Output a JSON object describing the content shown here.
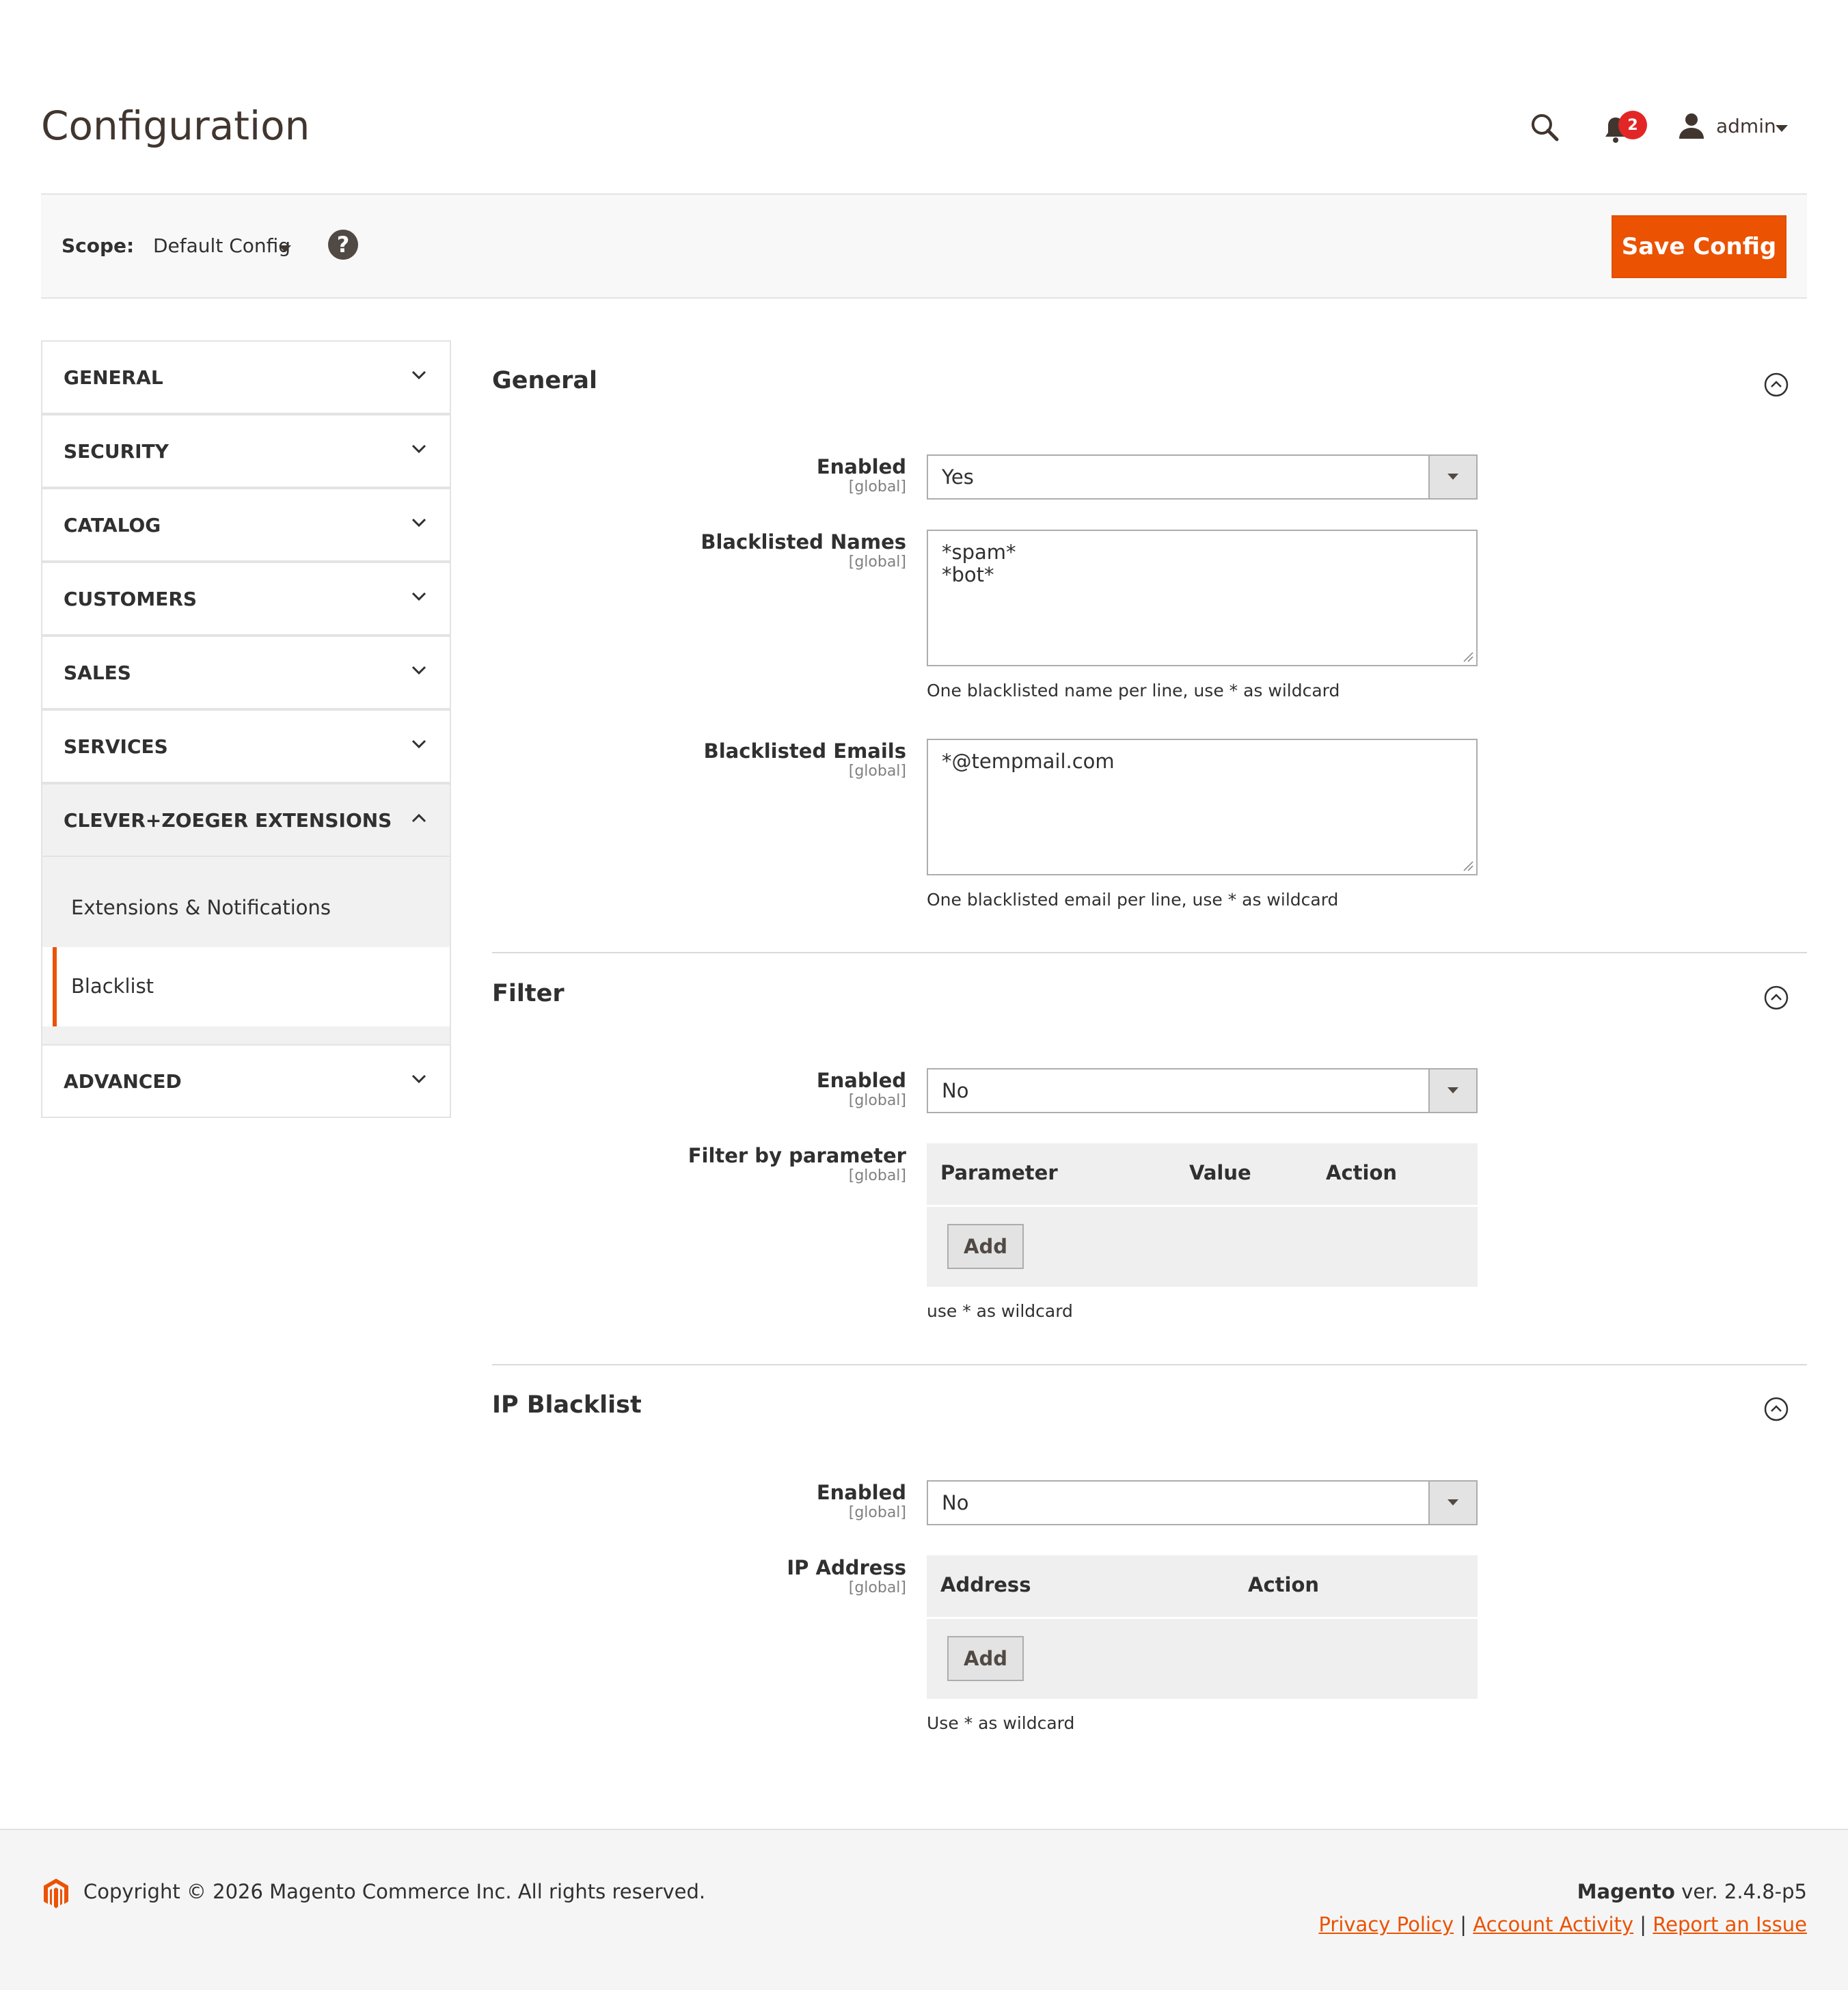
{
  "header": {
    "title": "Configuration",
    "search_icon": "search-icon",
    "notifications_count": "2",
    "user_name": "admin"
  },
  "scope": {
    "label": "Scope:",
    "value": "Default Config",
    "help": "?",
    "save_label": "Save Config"
  },
  "sidebar": {
    "items": [
      {
        "label": "GENERAL"
      },
      {
        "label": "SECURITY"
      },
      {
        "label": "CATALOG"
      },
      {
        "label": "CUSTOMERS"
      },
      {
        "label": "SALES"
      },
      {
        "label": "SERVICES"
      },
      {
        "label": "CLEVER+ZOEGER EXTENSIONS"
      },
      {
        "label": "ADVANCED"
      }
    ],
    "sub_items": [
      {
        "label": "Extensions & Notifications"
      },
      {
        "label": "Blacklist"
      }
    ]
  },
  "sections": {
    "general": {
      "title": "General",
      "enabled_label": "Enabled",
      "enabled_scope": "[global]",
      "enabled_value": "Yes",
      "names_label": "Blacklisted Names",
      "names_scope": "[global]",
      "names_lines": [
        "*spam*",
        "*bot*"
      ],
      "names_note": "One blacklisted name per line, use * as wildcard",
      "emails_label": "Blacklisted Emails",
      "emails_scope": "[global]",
      "emails_lines": [
        "*@tempmail.com"
      ],
      "emails_note": "One blacklisted email per line, use * as wildcard"
    },
    "filter": {
      "title": "Filter",
      "enabled_label": "Enabled",
      "enabled_scope": "[global]",
      "enabled_value": "No",
      "param_label": "Filter by parameter",
      "param_scope": "[global]",
      "columns": [
        "Parameter",
        "Value",
        "Action"
      ],
      "add_label": "Add",
      "note": "use * as wildcard"
    },
    "ip": {
      "title": "IP Blacklist",
      "enabled_label": "Enabled",
      "enabled_scope": "[global]",
      "enabled_value": "No",
      "ip_label": "IP Address",
      "ip_scope": "[global]",
      "columns": [
        "Address",
        "Action"
      ],
      "add_label": "Add",
      "note": "Use * as wildcard"
    }
  },
  "footer": {
    "copyright": "Copyright © 2026 Magento Commerce Inc. All rights reserved.",
    "brand": "Magento",
    "version": " ver. 2.4.8-p5",
    "links": [
      "Privacy Policy",
      "Account Activity",
      "Report an Issue"
    ],
    "separator": "|"
  },
  "colors": {
    "accent": "#eb5202",
    "badge": "#e22626",
    "title": "#41362f"
  }
}
